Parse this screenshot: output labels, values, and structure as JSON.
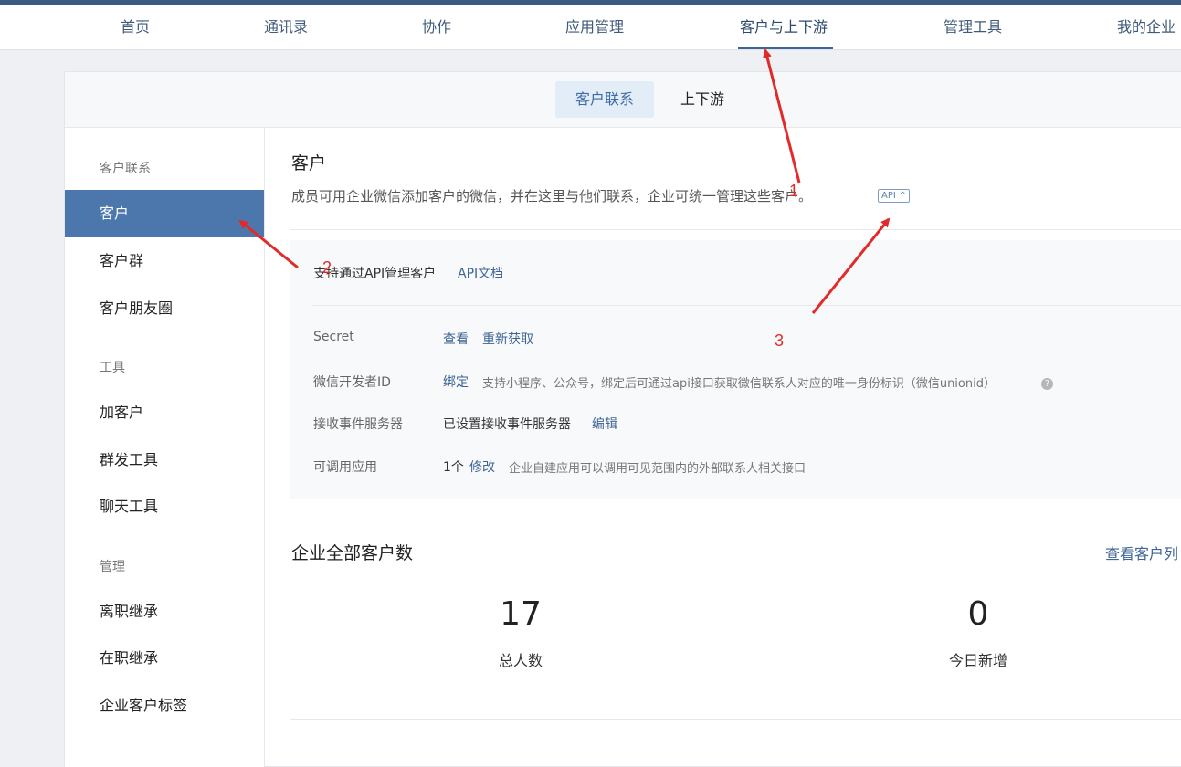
{
  "top_nav": {
    "items": [
      "首页",
      "通讯录",
      "协作",
      "应用管理",
      "客户与上下游",
      "管理工具",
      "我的企业"
    ],
    "active_index": 4
  },
  "sub_tabs": {
    "items": [
      "客户联系",
      "上下游"
    ],
    "active_index": 0
  },
  "sidebar": {
    "group_customer": "客户联系",
    "customer": "客户",
    "customer_group": "客户群",
    "moments": "客户朋友圈",
    "group_tools": "工具",
    "add_customer": "加客户",
    "mass_send": "群发工具",
    "chat_tool": "聊天工具",
    "group_manage": "管理",
    "resign_inherit": "离职继承",
    "onjob_inherit": "在职继承",
    "customer_tags": "企业客户标签"
  },
  "main": {
    "title": "客户",
    "description": "成员可用企业微信添加客户的微信，并在这里与他们联系，企业可统一管理这些客户。",
    "api_tag": "API ^",
    "api_panel": {
      "support_text": "支持通过API管理客户",
      "api_doc_link": "API文档",
      "secret_label": "Secret",
      "view_link": "查看",
      "regain_link": "重新获取",
      "wechat_dev_label": "微信开发者ID",
      "bind_link": "绑定",
      "bind_note": "支持小程序、公众号，绑定后可通过api接口获取微信联系人对应的唯一身份标识（微信unionid）",
      "help_icon": "?",
      "event_server_label": "接收事件服务器",
      "event_server_value": "已设置接收事件服务器",
      "edit_link": "编辑",
      "callable_apps_label": "可调用应用",
      "callable_apps_count": "1个",
      "modify_link": "修改",
      "callable_apps_note": "企业自建应用可以调用可见范围内的外部联系人相关接口"
    },
    "stats": {
      "title": "企业全部客户数",
      "view_list_link": "查看客户列",
      "total_value": "17",
      "total_label": "总人数",
      "today_value": "0",
      "today_label": "今日新增"
    }
  },
  "annotations": {
    "mark1": "1",
    "mark2": "2",
    "mark3": "3",
    "color": "#e12b2b"
  }
}
